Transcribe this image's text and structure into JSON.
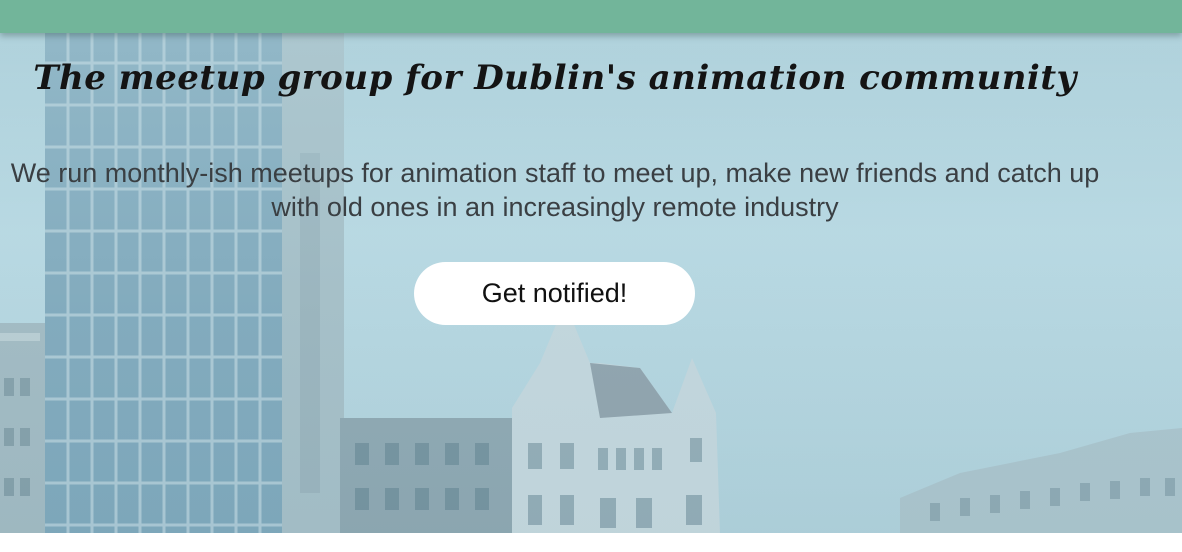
{
  "hero": {
    "title": "The meetup group for Dublin's animation community",
    "description": "We run monthly-ish meetups for animation staff to meet up, make new friends and catch up with old ones in an increasingly remote industry",
    "cta_label": "Get notified!"
  },
  "colors": {
    "topbar": "#72b59a",
    "sky": "#b8d9e3",
    "title_text": "#141414",
    "body_text": "#3a3f43",
    "button_bg": "#ffffff"
  }
}
